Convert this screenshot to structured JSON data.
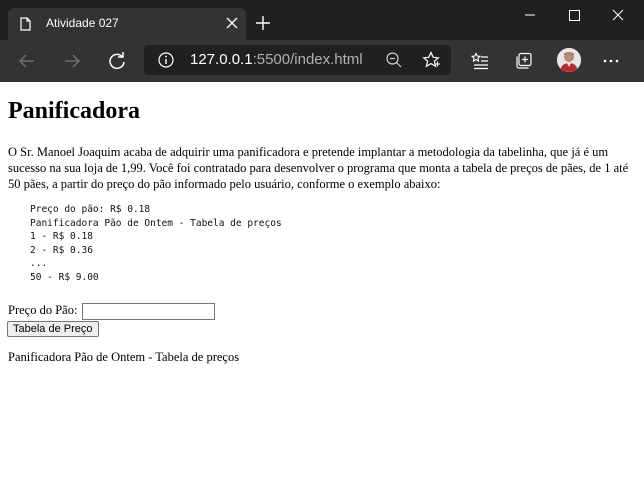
{
  "browser": {
    "tab_title": "Atividade 027",
    "url_host": "127.0.0.1",
    "url_rest": ":5500/index.html",
    "theme_color": "#202020"
  },
  "page": {
    "heading": "Panificadora",
    "description": "O Sr. Manoel Joaquim acaba de adquirir uma panificadora e pretende implantar a metodologia da tabelinha, que já é um sucesso na sua loja de 1,99. Você foi contratado para desenvolver o programa que monta a tabela de preços de pães, de 1 até 50 pães, a partir do preço do pão informado pelo usuário, conforme o exemplo abaixo:",
    "example": "Preço do pão: R$ 0.18\nPanificadora Pão de Ontem - Tabela de preços\n1 - R$ 0.18\n2 - R$ 0.36\n...\n50 - R$ 9.00",
    "price_label": "Preço do Pão:",
    "price_value": "",
    "button_label": "Tabela de Preço",
    "result_text": "Panificadora Pão de Ontem - Tabela de preços"
  },
  "icons": [
    "page-icon",
    "close-icon",
    "plus-icon",
    "minimize-icon",
    "maximize-icon",
    "close-window-icon",
    "back-icon",
    "forward-icon",
    "refresh-icon",
    "info-icon",
    "zoom-out-icon",
    "favorite-star-icon",
    "favorites-icon",
    "collections-icon",
    "avatar",
    "more-icon"
  ]
}
